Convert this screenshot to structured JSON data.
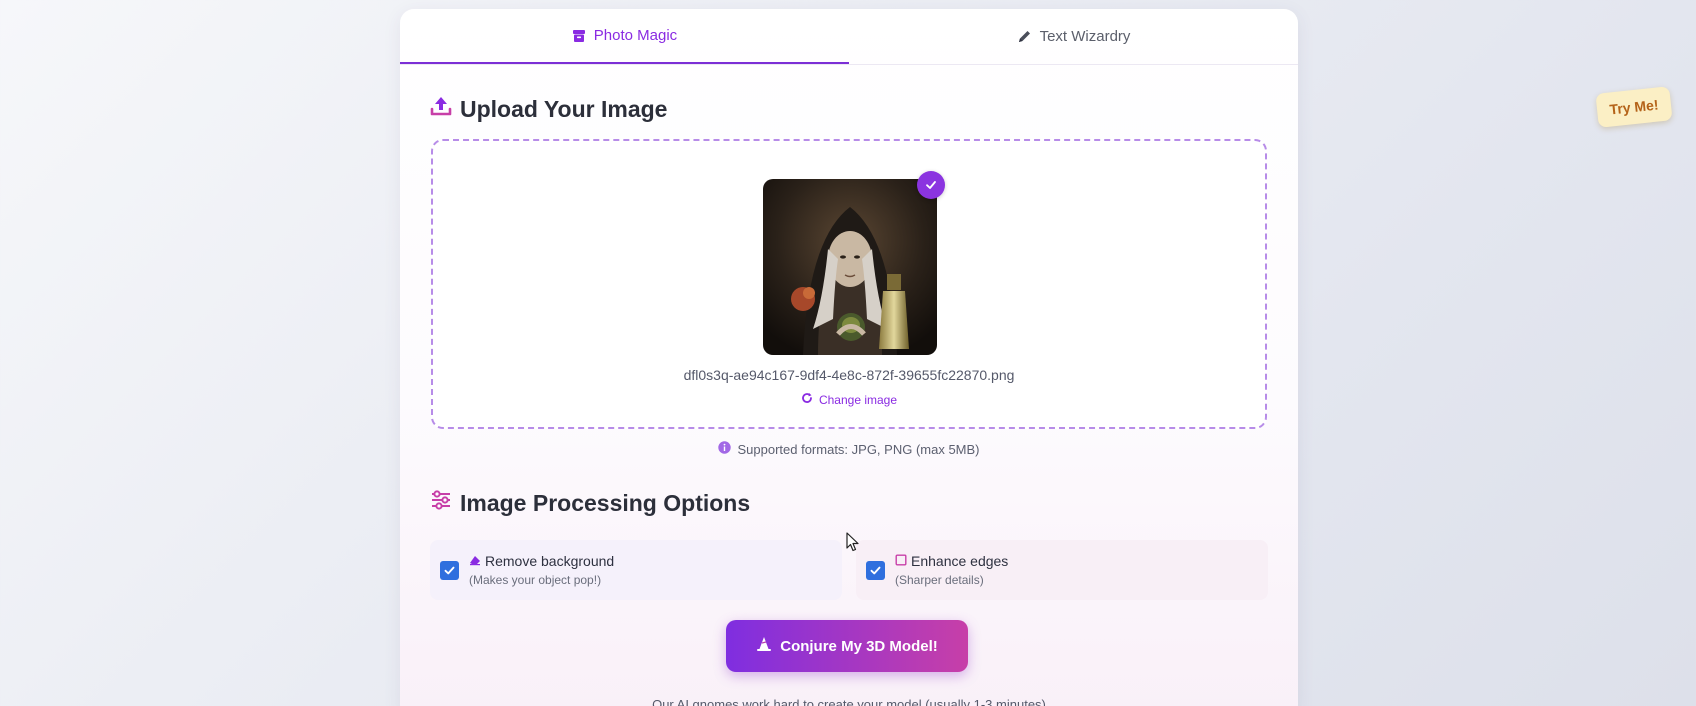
{
  "tabs": [
    {
      "label": "Photo Magic",
      "icon": "archive-icon",
      "active": true
    },
    {
      "label": "Text Wizardry",
      "icon": "pencil-icon",
      "active": false
    }
  ],
  "upload": {
    "title": "Upload Your Image",
    "icon": "upload-icon",
    "filename": "dfl0s3q-ae94c167-9df4-4e8c-872f-39655fc22870.png",
    "change_label": "Change image",
    "supported": "Supported formats: JPG, PNG (max 5MB)"
  },
  "options": {
    "title": "Image Processing Options",
    "icon": "sliders-icon",
    "items": [
      {
        "label": "Remove background",
        "sub": "(Makes your object pop!)",
        "checked": true,
        "icon": "eraser-icon"
      },
      {
        "label": "Enhance edges",
        "sub": "(Sharper details)",
        "checked": true,
        "icon": "square-icon"
      }
    ]
  },
  "action": {
    "button_label": "Conjure My 3D Model!",
    "icon": "wizard-hat-icon",
    "note": "Our AI gnomes work hard to create your model (usually 1-3 minutes)"
  },
  "try_me": "Try Me!",
  "colors": {
    "accent": "#8a2be2",
    "pink": "#c73fa8",
    "checkbox": "#2f6fde"
  }
}
